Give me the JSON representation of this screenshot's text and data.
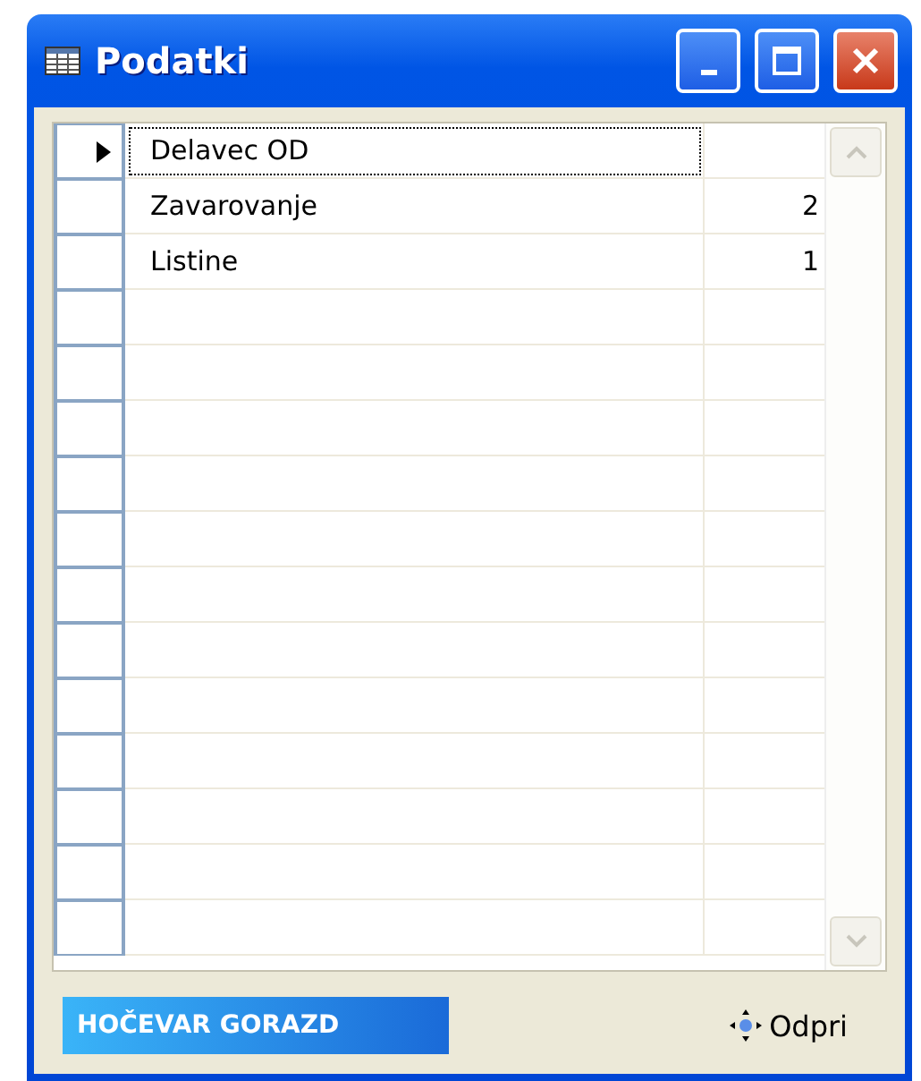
{
  "window": {
    "title": "Podatki"
  },
  "rows": [
    {
      "name": "Delavec OD",
      "count": "",
      "selected": true
    },
    {
      "name": "Zavarovanje",
      "count": "2",
      "selected": false
    },
    {
      "name": "Listine",
      "count": "1",
      "selected": false
    }
  ],
  "footer": {
    "badge": "HOČEVAR GORAZD",
    "action": "Odpri"
  }
}
